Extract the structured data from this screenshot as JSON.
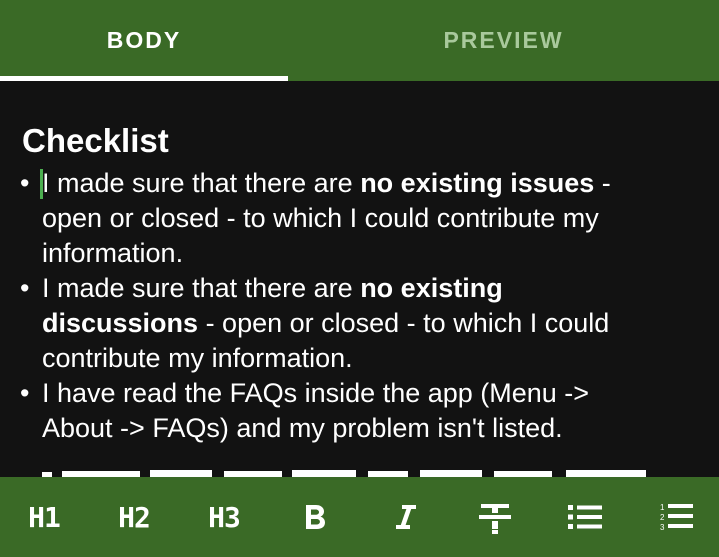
{
  "tabs": [
    {
      "label": "BODY",
      "active": true
    },
    {
      "label": "PREVIEW",
      "active": false
    }
  ],
  "editor": {
    "heading": "Checklist",
    "items": [
      {
        "lines": [
          {
            "pre": " I made sure that there are ",
            "bold": "no existing issues",
            "post": " -"
          },
          {
            "pre": "open or closed - to which I could contribute my",
            "bold": "",
            "post": ""
          },
          {
            "pre": "information.",
            "bold": "",
            "post": ""
          }
        ]
      },
      {
        "lines": [
          {
            "pre": " I made sure that there are ",
            "bold": "no existing",
            "post": ""
          },
          {
            "pre": "",
            "bold": "discussions",
            "post": " - open or closed - to which I could"
          },
          {
            "pre": "contribute my information.",
            "bold": "",
            "post": ""
          }
        ]
      },
      {
        "lines": [
          {
            "pre": " I have read the FAQs inside the app (Menu ->",
            "bold": "",
            "post": ""
          },
          {
            "pre": "About -> FAQs) and my problem isn't listed.",
            "bold": "",
            "post": ""
          }
        ]
      }
    ]
  },
  "toolbar": {
    "h1": "H1",
    "h2": "H2",
    "h3": "H3",
    "bold_icon": "bold-icon",
    "italic_icon": "italic-icon",
    "strike_icon": "strikethrough-icon",
    "bullet_icon": "bulleted-list-icon",
    "numbered_icon": "numbered-list-icon"
  },
  "colors": {
    "accent": "#3a6a26",
    "background": "#121212",
    "caret": "#4caf50",
    "inactive_tab": "#a9c99c"
  }
}
